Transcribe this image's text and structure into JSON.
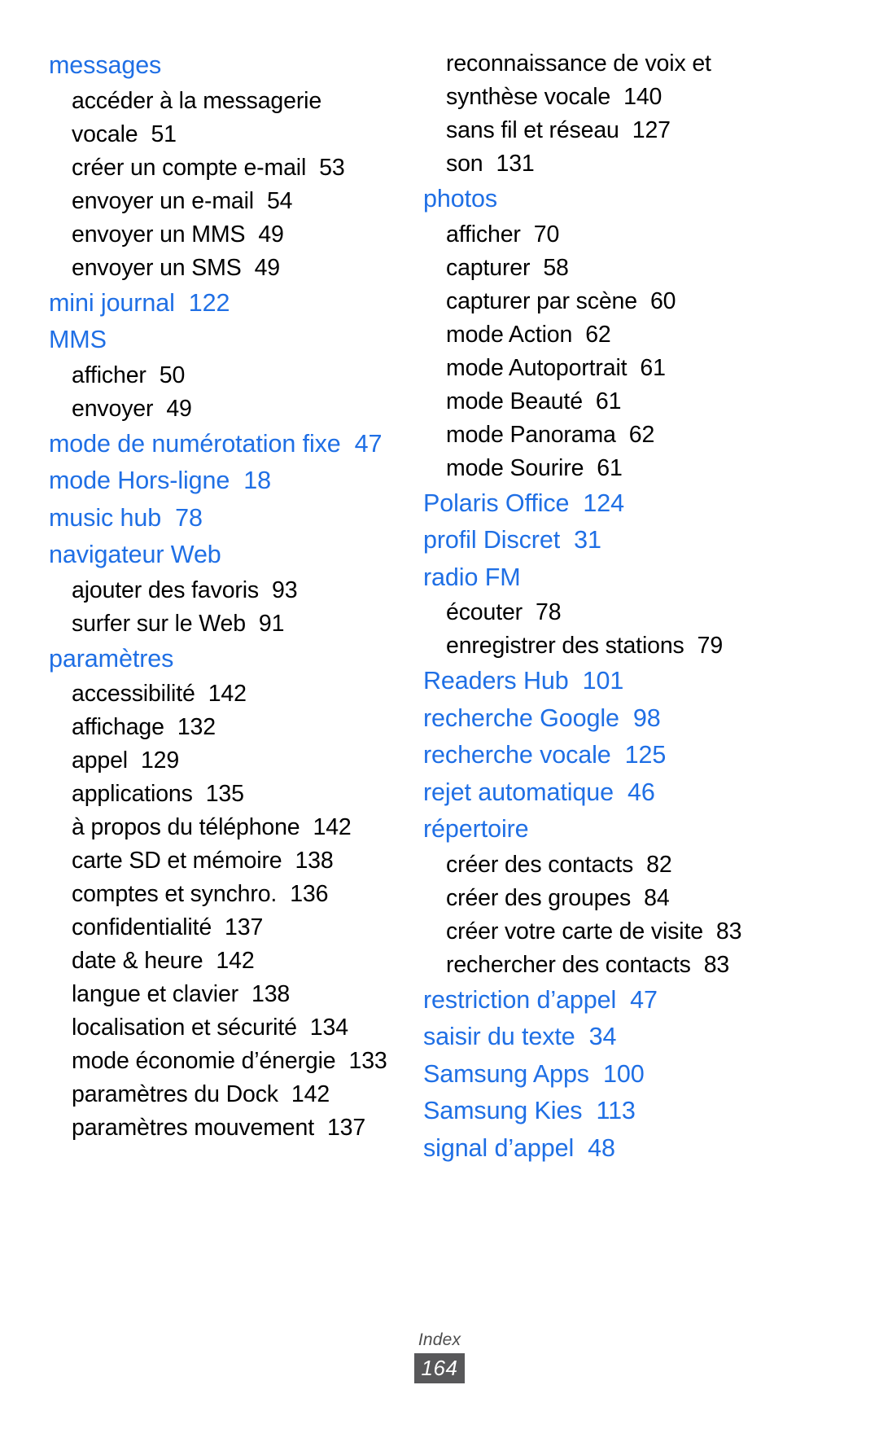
{
  "footer": {
    "label": "Index",
    "page_number": "164",
    "page_badge_bg": "#58585a"
  },
  "colors": {
    "main_entry": "#1f6fe5",
    "sub_entry": "#000000",
    "page_background": "#ffffff"
  },
  "left_column": [
    {
      "title": "messages",
      "page": "",
      "subs": [
        {
          "label": "accéder à la messagerie vocale",
          "page": "51"
        },
        {
          "label": "créer un compte e-mail",
          "page": "53"
        },
        {
          "label": "envoyer un e-mail",
          "page": "54"
        },
        {
          "label": "envoyer un MMS",
          "page": "49"
        },
        {
          "label": "envoyer un SMS",
          "page": "49"
        }
      ]
    },
    {
      "title": "mini journal",
      "page": "122",
      "subs": []
    },
    {
      "title": "MMS",
      "page": "",
      "subs": [
        {
          "label": "afficher",
          "page": "50"
        },
        {
          "label": "envoyer",
          "page": "49"
        }
      ]
    },
    {
      "title": "mode de numérotation fixe",
      "page": "47",
      "subs": []
    },
    {
      "title": "mode Hors-ligne",
      "page": "18",
      "subs": []
    },
    {
      "title": "music hub",
      "page": "78",
      "subs": []
    },
    {
      "title": "navigateur Web",
      "page": "",
      "subs": [
        {
          "label": "ajouter des favoris",
          "page": "93"
        },
        {
          "label": "surfer sur le Web",
          "page": "91"
        }
      ]
    },
    {
      "title": "paramètres",
      "page": "",
      "subs": [
        {
          "label": "accessibilité",
          "page": "142"
        },
        {
          "label": "affichage",
          "page": "132"
        },
        {
          "label": "appel",
          "page": "129"
        },
        {
          "label": "applications",
          "page": "135"
        },
        {
          "label": "à propos du téléphone",
          "page": "142"
        },
        {
          "label": "carte SD et mémoire",
          "page": "138"
        },
        {
          "label": "comptes et synchro.",
          "page": "136"
        },
        {
          "label": "confidentialité",
          "page": "137"
        },
        {
          "label": "date & heure",
          "page": "142"
        },
        {
          "label": "langue et clavier",
          "page": "138"
        },
        {
          "label": "localisation et sécurité",
          "page": "134"
        },
        {
          "label": "mode économie d’énergie",
          "page": "133"
        },
        {
          "label": "paramètres du Dock",
          "page": "142"
        },
        {
          "label": "paramètres mouvement",
          "page": "137"
        }
      ]
    }
  ],
  "right_column_continued_subs": [
    {
      "label": "reconnaissance de voix et synthèse vocale",
      "page": "140"
    },
    {
      "label": "sans fil et réseau",
      "page": "127"
    },
    {
      "label": "son",
      "page": "131"
    }
  ],
  "right_column": [
    {
      "title": "photos",
      "page": "",
      "subs": [
        {
          "label": "afficher",
          "page": "70"
        },
        {
          "label": "capturer",
          "page": "58"
        },
        {
          "label": "capturer par scène",
          "page": "60"
        },
        {
          "label": "mode Action",
          "page": "62"
        },
        {
          "label": "mode Autoportrait",
          "page": "61"
        },
        {
          "label": "mode Beauté",
          "page": "61"
        },
        {
          "label": "mode Panorama",
          "page": "62"
        },
        {
          "label": "mode Sourire",
          "page": "61"
        }
      ]
    },
    {
      "title": "Polaris Office",
      "page": "124",
      "subs": []
    },
    {
      "title": "profil Discret",
      "page": "31",
      "subs": []
    },
    {
      "title": "radio FM",
      "page": "",
      "subs": [
        {
          "label": "écouter",
          "page": "78"
        },
        {
          "label": "enregistrer des stations",
          "page": "79"
        }
      ]
    },
    {
      "title": "Readers Hub",
      "page": "101",
      "subs": []
    },
    {
      "title": "recherche Google",
      "page": "98",
      "subs": []
    },
    {
      "title": "recherche vocale",
      "page": "125",
      "subs": []
    },
    {
      "title": "rejet automatique",
      "page": "46",
      "subs": []
    },
    {
      "title": "répertoire",
      "page": "",
      "subs": [
        {
          "label": "créer des contacts",
          "page": "82"
        },
        {
          "label": "créer des groupes",
          "page": "84"
        },
        {
          "label": "créer votre carte de visite",
          "page": "83"
        },
        {
          "label": "rechercher des contacts",
          "page": "83"
        }
      ]
    },
    {
      "title": "restriction d’appel",
      "page": "47",
      "subs": []
    },
    {
      "title": "saisir du texte",
      "page": "34",
      "subs": []
    },
    {
      "title": "Samsung Apps",
      "page": "100",
      "subs": []
    },
    {
      "title": "Samsung Kies",
      "page": "113",
      "subs": []
    },
    {
      "title": "signal d’appel",
      "page": "48",
      "subs": []
    }
  ]
}
